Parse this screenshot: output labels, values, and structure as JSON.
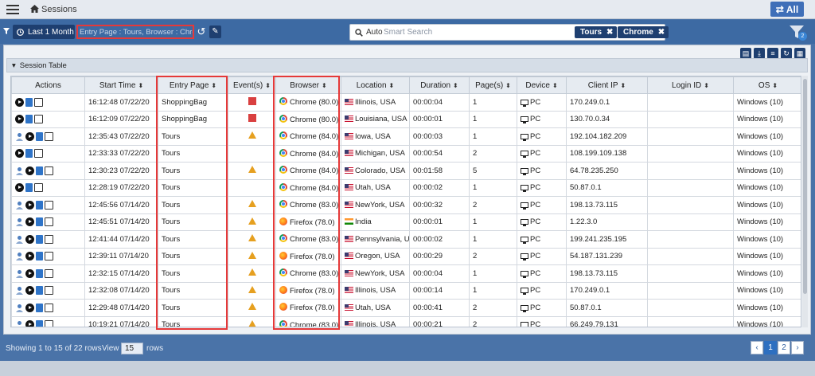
{
  "header": {
    "title": "Sessions",
    "all_label": "All"
  },
  "filters": {
    "date_range": "Last 1 Month",
    "active_filter": "Entry Page : Tours, Browser : Chrome",
    "search_mode": "Auto",
    "search_placeholder": "Smart Search",
    "chips": [
      "Tours",
      "Chrome"
    ],
    "filter_count": "2"
  },
  "section": {
    "title": "Session Table"
  },
  "columns": [
    "Actions",
    "Start Time",
    "Entry Page",
    "Event(s)",
    "Browser",
    "Location",
    "Duration",
    "Page(s)",
    "Device",
    "Client IP",
    "Login ID",
    "OS"
  ],
  "rows": [
    {
      "user": false,
      "start": "16:12:48 07/22/20",
      "entry": "ShoppingBag",
      "event": "error",
      "browser": "Chrome (80.0)",
      "bicon": "chrome",
      "flag": "us",
      "location": "Illinois, USA",
      "duration": "00:00:04",
      "pages": "1",
      "device": "PC",
      "ip": "170.249.0.1",
      "login": "",
      "os": "Windows (10)"
    },
    {
      "user": false,
      "start": "16:12:09 07/22/20",
      "entry": "ShoppingBag",
      "event": "error",
      "browser": "Chrome (80.0)",
      "bicon": "chrome",
      "flag": "us",
      "location": "Louisiana, USA",
      "duration": "00:00:01",
      "pages": "1",
      "device": "PC",
      "ip": "130.70.0.34",
      "login": "",
      "os": "Windows (10)"
    },
    {
      "user": true,
      "start": "12:35:43 07/22/20",
      "entry": "Tours",
      "event": "warning",
      "browser": "Chrome (84.0)",
      "bicon": "chrome",
      "flag": "us",
      "location": "Iowa, USA",
      "duration": "00:00:03",
      "pages": "1",
      "device": "PC",
      "ip": "192.104.182.209",
      "login": "",
      "os": "Windows (10)"
    },
    {
      "user": false,
      "start": "12:33:33 07/22/20",
      "entry": "Tours",
      "event": "",
      "browser": "Chrome (84.0)",
      "bicon": "chrome",
      "flag": "us",
      "location": "Michigan, USA",
      "duration": "00:00:54",
      "pages": "2",
      "device": "PC",
      "ip": "108.199.109.138",
      "login": "",
      "os": "Windows (10)"
    },
    {
      "user": true,
      "start": "12:30:23 07/22/20",
      "entry": "Tours",
      "event": "warning",
      "browser": "Chrome (84.0)",
      "bicon": "chrome",
      "flag": "us",
      "location": "Colorado, USA",
      "duration": "00:01:58",
      "pages": "5",
      "device": "PC",
      "ip": "64.78.235.250",
      "login": "",
      "os": "Windows (10)"
    },
    {
      "user": false,
      "start": "12:28:19 07/22/20",
      "entry": "Tours",
      "event": "",
      "browser": "Chrome (84.0)",
      "bicon": "chrome",
      "flag": "us",
      "location": "Utah, USA",
      "duration": "00:00:02",
      "pages": "1",
      "device": "PC",
      "ip": "50.87.0.1",
      "login": "",
      "os": "Windows (10)"
    },
    {
      "user": true,
      "start": "12:45:56 07/14/20",
      "entry": "Tours",
      "event": "warning",
      "browser": "Chrome (83.0)",
      "bicon": "chrome",
      "flag": "us",
      "location": "NewYork, USA",
      "duration": "00:00:32",
      "pages": "2",
      "device": "PC",
      "ip": "198.13.73.115",
      "login": "",
      "os": "Windows (10)"
    },
    {
      "user": true,
      "start": "12:45:51 07/14/20",
      "entry": "Tours",
      "event": "warning",
      "browser": "Firefox (78.0)",
      "bicon": "firefox",
      "flag": "in",
      "location": "India",
      "duration": "00:00:01",
      "pages": "1",
      "device": "PC",
      "ip": "1.22.3.0",
      "login": "",
      "os": "Windows (10)"
    },
    {
      "user": true,
      "start": "12:41:44 07/14/20",
      "entry": "Tours",
      "event": "warning",
      "browser": "Chrome (83.0)",
      "bicon": "chrome",
      "flag": "us",
      "location": "Pennsylvania, USA",
      "duration": "00:00:02",
      "pages": "1",
      "device": "PC",
      "ip": "199.241.235.195",
      "login": "",
      "os": "Windows (10)"
    },
    {
      "user": true,
      "start": "12:39:11 07/14/20",
      "entry": "Tours",
      "event": "warning",
      "browser": "Firefox (78.0)",
      "bicon": "firefox",
      "flag": "us",
      "location": "Oregon, USA",
      "duration": "00:00:29",
      "pages": "2",
      "device": "PC",
      "ip": "54.187.131.239",
      "login": "",
      "os": "Windows (10)"
    },
    {
      "user": true,
      "start": "12:32:15 07/14/20",
      "entry": "Tours",
      "event": "warning",
      "browser": "Chrome (83.0)",
      "bicon": "chrome",
      "flag": "us",
      "location": "NewYork, USA",
      "duration": "00:00:04",
      "pages": "1",
      "device": "PC",
      "ip": "198.13.73.115",
      "login": "",
      "os": "Windows (10)"
    },
    {
      "user": true,
      "start": "12:32:08 07/14/20",
      "entry": "Tours",
      "event": "warning",
      "browser": "Firefox (78.0)",
      "bicon": "firefox",
      "flag": "us",
      "location": "Illinois, USA",
      "duration": "00:00:14",
      "pages": "1",
      "device": "PC",
      "ip": "170.249.0.1",
      "login": "",
      "os": "Windows (10)"
    },
    {
      "user": true,
      "start": "12:29:48 07/14/20",
      "entry": "Tours",
      "event": "warning",
      "browser": "Firefox (78.0)",
      "bicon": "firefox",
      "flag": "us",
      "location": "Utah, USA",
      "duration": "00:00:41",
      "pages": "2",
      "device": "PC",
      "ip": "50.87.0.1",
      "login": "",
      "os": "Windows (10)"
    },
    {
      "user": true,
      "start": "10:19:21 07/14/20",
      "entry": "Tours",
      "event": "warning",
      "browser": "Chrome (83.0)",
      "bicon": "chrome",
      "flag": "us",
      "location": "Illinois, USA",
      "duration": "00:00:21",
      "pages": "2",
      "device": "PC",
      "ip": "66.249.79.131",
      "login": "",
      "os": "Windows (10)"
    }
  ],
  "footer": {
    "showing": "Showing 1 to 15 of 22 rows",
    "view_label": "View",
    "page_size": "15",
    "rows_label": "rows",
    "pages": [
      "1",
      "2"
    ],
    "prev": "‹",
    "next": "›"
  }
}
